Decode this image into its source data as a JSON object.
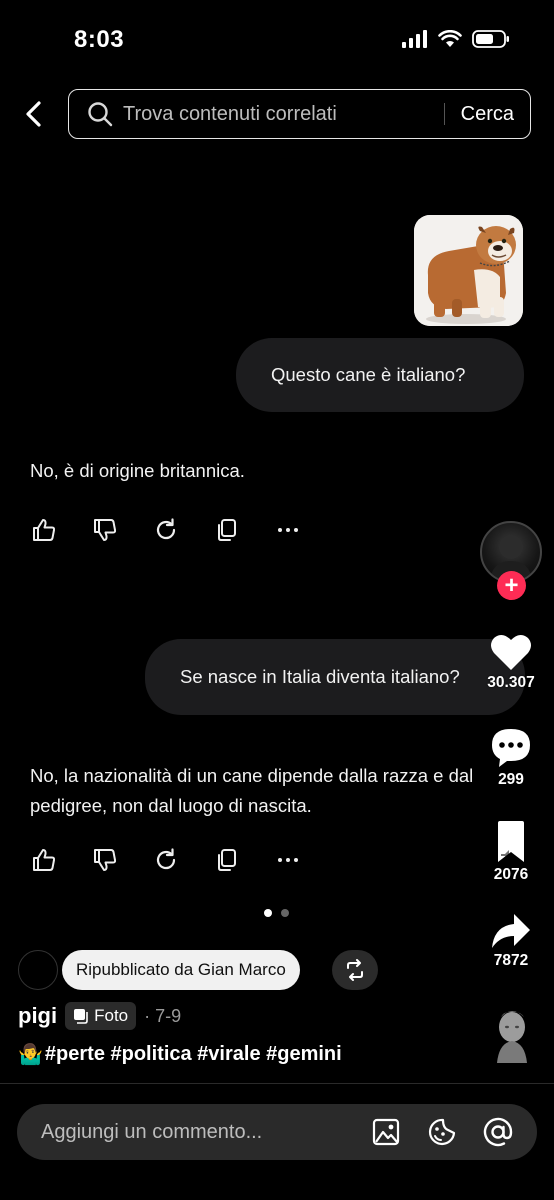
{
  "status_bar": {
    "time": "8:03"
  },
  "search": {
    "placeholder": "Trova contenuti correlati",
    "button_label": "Cerca"
  },
  "chat": {
    "messages": [
      {
        "role": "user",
        "text": "Questo cane è italiano?"
      },
      {
        "role": "assistant",
        "text": "No, è di origine britannica."
      },
      {
        "role": "user",
        "text": "Se nasce in Italia diventa italiano?"
      },
      {
        "role": "assistant",
        "text": "No, la nazionalità di un cane dipende dalla razza e dal pedigree, non dal luogo di nascita."
      }
    ],
    "action_icons": [
      "thumbs-up-icon",
      "thumbs-down-icon",
      "refresh-icon",
      "copy-icon",
      "more-icon"
    ]
  },
  "carousel": {
    "current_page": 1,
    "total_pages": 2
  },
  "right_rail": {
    "likes": "30.307",
    "comments": "299",
    "saves": "2076",
    "shares": "7872"
  },
  "repost": {
    "label": "Ripubblicato da Gian Marco"
  },
  "post": {
    "author": "pigi",
    "type_tag": "Foto",
    "date": "· 7-9",
    "caption_emoji": "🤷‍♂️",
    "caption": "#perte #politica #virale #gemini"
  },
  "comment_bar": {
    "placeholder": "Aggiungi un commento..."
  },
  "colors": {
    "background": "#000000",
    "bubble": "#1c1c1e",
    "follow_accent": "#fe2c55"
  }
}
